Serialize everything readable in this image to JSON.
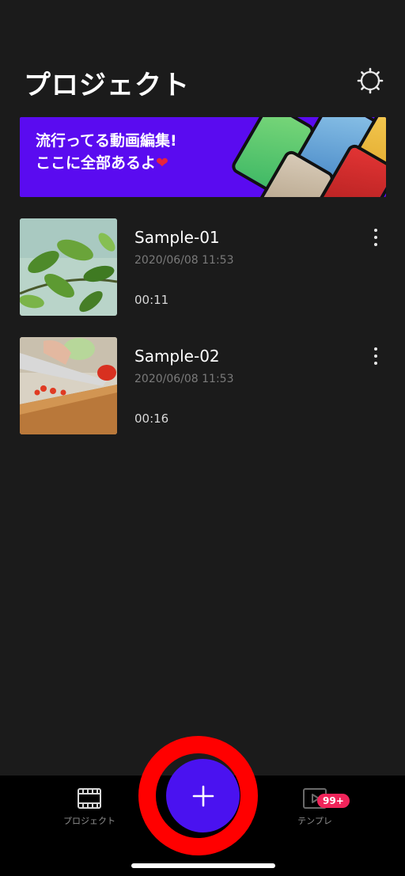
{
  "header": {
    "title": "プロジェクト"
  },
  "banner": {
    "line1": "流行ってる動画編集!",
    "line2": "ここに全部あるよ",
    "heart": "❤"
  },
  "projects": [
    {
      "name": "Sample-01",
      "date": "2020/06/08 11:53",
      "duration": "00:11",
      "thumbnail": "leaves-photo"
    },
    {
      "name": "Sample-02",
      "date": "2020/06/08 11:53",
      "duration": "00:16",
      "thumbnail": "cutting-tomato-photo"
    }
  ],
  "bottom_nav": {
    "projects_label": "プロジェクト",
    "add_label": "+",
    "templates_label": "テンプレ",
    "templates_badge": "99+"
  },
  "colors": {
    "background": "#1b1b1b",
    "banner": "#5a0bf0",
    "add_button": "#4a12f0",
    "badge": "#f0245a",
    "highlight_ring": "#ff0000"
  },
  "icons": {
    "settings": "settings-gear-icon",
    "more": "more-vertical-icon",
    "projects_tab": "film-strip-icon",
    "templates_tab": "play-box-icon",
    "add": "plus-icon"
  }
}
